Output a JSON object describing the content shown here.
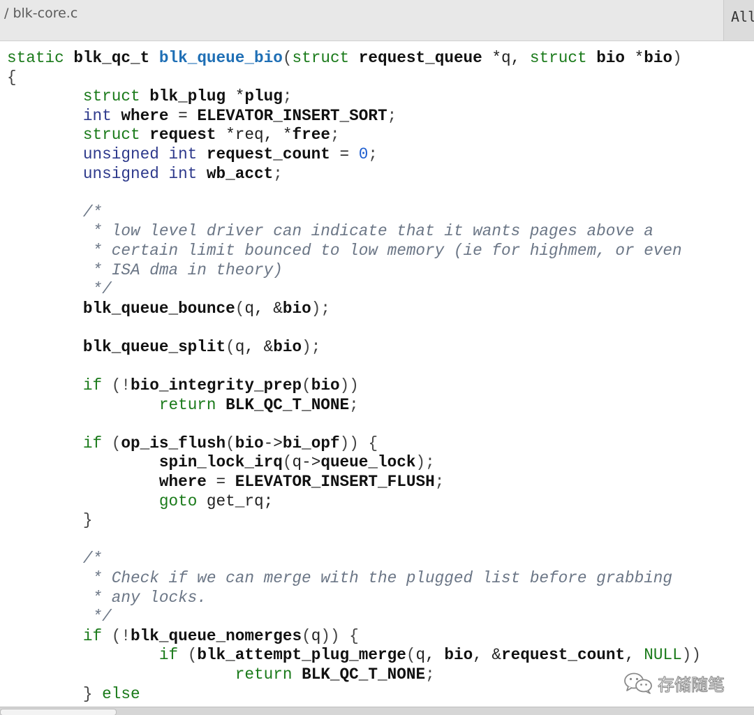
{
  "header": {
    "breadcrumb": "/ blk-core.c",
    "right_pane_label": "All"
  },
  "code": {
    "lines": [
      [
        [
          "kw",
          "static "
        ],
        [
          "b",
          "blk_qc_t "
        ],
        [
          "fn",
          "blk_queue_bio"
        ],
        [
          "p",
          "("
        ],
        [
          "kw",
          "struct "
        ],
        [
          "b",
          "request_queue "
        ],
        [
          "plain",
          "*q, "
        ],
        [
          "kw",
          "struct "
        ],
        [
          "b",
          "bio "
        ],
        [
          "plain",
          "*"
        ],
        [
          "b",
          "bio"
        ],
        [
          "p",
          ")"
        ]
      ],
      [
        [
          "p",
          "{"
        ]
      ],
      [
        [
          "plain",
          "        "
        ],
        [
          "kw",
          "struct "
        ],
        [
          "b",
          "blk_plug "
        ],
        [
          "plain",
          "*"
        ],
        [
          "b",
          "plug"
        ],
        [
          "p",
          ";"
        ]
      ],
      [
        [
          "plain",
          "        "
        ],
        [
          "type",
          "int "
        ],
        [
          "b",
          "where "
        ],
        [
          "plain",
          "= "
        ],
        [
          "b",
          "ELEVATOR_INSERT_SORT"
        ],
        [
          "p",
          ";"
        ]
      ],
      [
        [
          "plain",
          "        "
        ],
        [
          "kw",
          "struct "
        ],
        [
          "b",
          "request "
        ],
        [
          "plain",
          "*req, *"
        ],
        [
          "b",
          "free"
        ],
        [
          "p",
          ";"
        ]
      ],
      [
        [
          "plain",
          "        "
        ],
        [
          "type",
          "unsigned int "
        ],
        [
          "b",
          "request_count "
        ],
        [
          "plain",
          "= "
        ],
        [
          "num",
          "0"
        ],
        [
          "p",
          ";"
        ]
      ],
      [
        [
          "plain",
          "        "
        ],
        [
          "type",
          "unsigned int "
        ],
        [
          "b",
          "wb_acct"
        ],
        [
          "p",
          ";"
        ]
      ],
      [],
      [
        [
          "plain",
          "        "
        ],
        [
          "com",
          "/*"
        ]
      ],
      [
        [
          "plain",
          "        "
        ],
        [
          "com",
          " * low level driver can indicate that it wants pages above a"
        ]
      ],
      [
        [
          "plain",
          "        "
        ],
        [
          "com",
          " * certain limit bounced to low memory (ie for highmem, or even"
        ]
      ],
      [
        [
          "plain",
          "        "
        ],
        [
          "com",
          " * ISA dma in theory)"
        ]
      ],
      [
        [
          "plain",
          "        "
        ],
        [
          "com",
          " */"
        ]
      ],
      [
        [
          "plain",
          "        "
        ],
        [
          "b",
          "blk_queue_bounce"
        ],
        [
          "p",
          "("
        ],
        [
          "plain",
          "q, &"
        ],
        [
          "b",
          "bio"
        ],
        [
          "p",
          ");"
        ]
      ],
      [],
      [
        [
          "plain",
          "        "
        ],
        [
          "b",
          "blk_queue_split"
        ],
        [
          "p",
          "("
        ],
        [
          "plain",
          "q, &"
        ],
        [
          "b",
          "bio"
        ],
        [
          "p",
          ");"
        ]
      ],
      [],
      [
        [
          "plain",
          "        "
        ],
        [
          "kw",
          "if "
        ],
        [
          "p",
          "(!"
        ],
        [
          "b",
          "bio_integrity_prep"
        ],
        [
          "p",
          "("
        ],
        [
          "b",
          "bio"
        ],
        [
          "p",
          "))"
        ]
      ],
      [
        [
          "plain",
          "                "
        ],
        [
          "kw",
          "return "
        ],
        [
          "b",
          "BLK_QC_T_NONE"
        ],
        [
          "p",
          ";"
        ]
      ],
      [],
      [
        [
          "plain",
          "        "
        ],
        [
          "kw",
          "if "
        ],
        [
          "p",
          "("
        ],
        [
          "b",
          "op_is_flush"
        ],
        [
          "p",
          "("
        ],
        [
          "b",
          "bio"
        ],
        [
          "plain",
          "->"
        ],
        [
          "b",
          "bi_opf"
        ],
        [
          "p",
          ")) {"
        ]
      ],
      [
        [
          "plain",
          "                "
        ],
        [
          "b",
          "spin_lock_irq"
        ],
        [
          "p",
          "("
        ],
        [
          "plain",
          "q->"
        ],
        [
          "b",
          "queue_lock"
        ],
        [
          "p",
          ");"
        ]
      ],
      [
        [
          "plain",
          "                "
        ],
        [
          "b",
          "where "
        ],
        [
          "plain",
          "= "
        ],
        [
          "b",
          "ELEVATOR_INSERT_FLUSH"
        ],
        [
          "p",
          ";"
        ]
      ],
      [
        [
          "plain",
          "                "
        ],
        [
          "kw",
          "goto "
        ],
        [
          "plain",
          "get_rq;"
        ]
      ],
      [
        [
          "plain",
          "        "
        ],
        [
          "p",
          "}"
        ]
      ],
      [],
      [
        [
          "plain",
          "        "
        ],
        [
          "com",
          "/*"
        ]
      ],
      [
        [
          "plain",
          "        "
        ],
        [
          "com",
          " * Check if we can merge with the plugged list before grabbing"
        ]
      ],
      [
        [
          "plain",
          "        "
        ],
        [
          "com",
          " * any locks."
        ]
      ],
      [
        [
          "plain",
          "        "
        ],
        [
          "com",
          " */"
        ]
      ],
      [
        [
          "plain",
          "        "
        ],
        [
          "kw",
          "if "
        ],
        [
          "p",
          "(!"
        ],
        [
          "b",
          "blk_queue_nomerges"
        ],
        [
          "p",
          "("
        ],
        [
          "plain",
          "q"
        ],
        [
          "p",
          ")) {"
        ]
      ],
      [
        [
          "plain",
          "                "
        ],
        [
          "kw",
          "if "
        ],
        [
          "p",
          "("
        ],
        [
          "b",
          "blk_attempt_plug_merge"
        ],
        [
          "p",
          "("
        ],
        [
          "plain",
          "q, "
        ],
        [
          "b",
          "bio"
        ],
        [
          "plain",
          ", &"
        ],
        [
          "b",
          "request_count"
        ],
        [
          "plain",
          ", "
        ],
        [
          "kw",
          "NULL"
        ],
        [
          "p",
          "))"
        ]
      ],
      [
        [
          "plain",
          "                        "
        ],
        [
          "kw",
          "return "
        ],
        [
          "b",
          "BLK_QC_T_NONE"
        ],
        [
          "p",
          ";"
        ]
      ],
      [
        [
          "plain",
          "        "
        ],
        [
          "p",
          "} "
        ],
        [
          "kw",
          "else"
        ]
      ]
    ]
  },
  "watermark": {
    "icon": "wechat-icon",
    "text": "存储随笔"
  }
}
